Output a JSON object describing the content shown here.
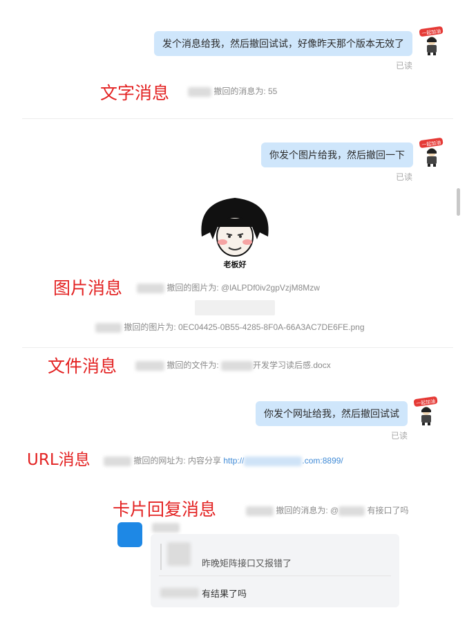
{
  "messages": {
    "text_msg": "发个消息给我，然后撤回试试，好像昨天那个版本无效了",
    "image_msg": "你发个图片给我，然后撤回一下",
    "url_msg": "你发个网址给我，然后撤回试试"
  },
  "read_label": "已读",
  "avatar_badge": "一起加油",
  "annotations": {
    "text": "文字消息",
    "image": "图片消息",
    "file": "文件消息",
    "url": "URL消息",
    "card": "卡片回复消息"
  },
  "recall": {
    "text": "撤回的消息为: 55",
    "image1": "撤回的图片为: @lALPDf0iv2gpVzjM8Mzw",
    "image2": "撤回的图片为: 0EC04425-0B55-4285-8F0A-66A3AC7DE6FE.png",
    "file_prefix": "撤回的文件为:",
    "file_name": "开发学习读后感.docx",
    "url_prefix": "撤回的网址为: 内容分享 ",
    "url_start": "http://",
    "url_end": ".com:8899/",
    "card_prefix": "撤回的消息为: @",
    "card_suffix": "有接口了吗"
  },
  "sticker_caption": "老板好",
  "card": {
    "quote_text": "昨晚矩阵接口又报错了",
    "reply_text": "有结果了吗"
  },
  "colors": {
    "bubble": "#cfe6fb",
    "annotation": "#e32222",
    "link": "#3f8ad6",
    "card_avatar": "#1e88e5"
  }
}
